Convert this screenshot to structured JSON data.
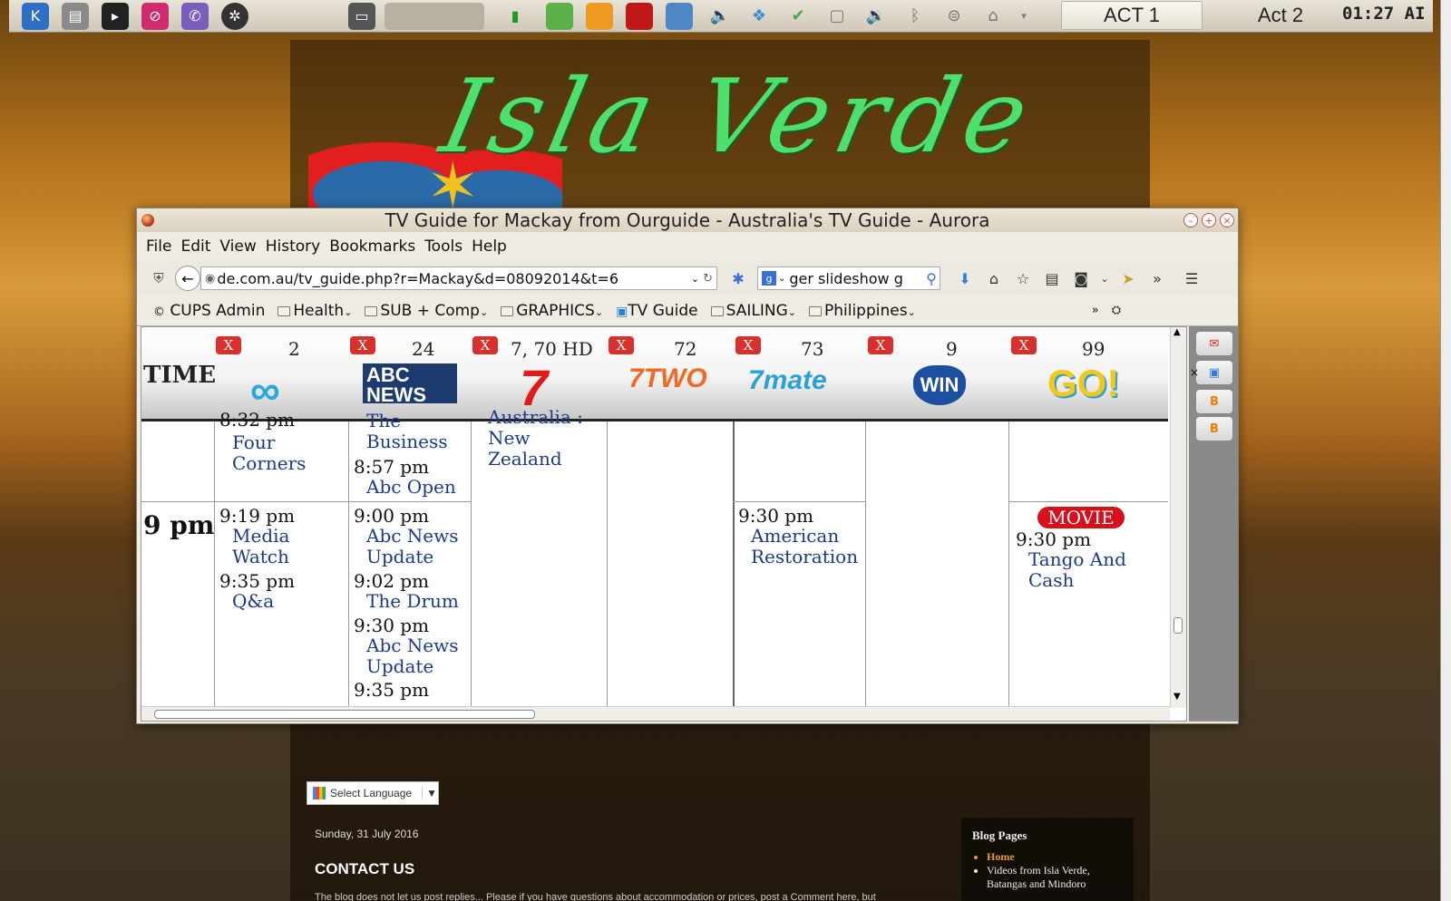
{
  "panel": {
    "act1": "ACT 1",
    "act2": "Act 2",
    "clock": "01:27 AI"
  },
  "blog": {
    "title": "Isla Verde",
    "language_select": "Select Language",
    "post_date": "Sunday, 31 July 2016",
    "post_title": "CONTACT US",
    "post_body": "The blog does not let us post replies... Please if you have questions about accommodation or prices, post a Comment here, but",
    "sidebar_title": "Blog Pages",
    "sidebar_items": [
      "Home",
      "Videos from Isla Verde, Batangas and Mindoro"
    ]
  },
  "browser": {
    "title": "TV Guide for Mackay from Ourguide - Australia's TV Guide - Aurora",
    "menu": [
      "File",
      "Edit",
      "View",
      "History",
      "Bookmarks",
      "Tools",
      "Help"
    ],
    "url": "de.com.au/tv_guide.php?r=Mackay&d=08092014&t=6",
    "search": "ger slideshow g",
    "bookmarks": [
      "CUPS Admin",
      "Health",
      "SUB + Comp",
      "GRAPHICS",
      "TV Guide",
      "SAILING",
      "Philippines"
    ]
  },
  "guide": {
    "time_header": "TIME",
    "close_label": "X",
    "channels": [
      {
        "num": "2",
        "logo": "ABC"
      },
      {
        "num": "24",
        "logo": "ABC NEWS 24"
      },
      {
        "num": "7, 70 HD",
        "logo": "7"
      },
      {
        "num": "72",
        "logo": "7TWO"
      },
      {
        "num": "73",
        "logo": "7mate"
      },
      {
        "num": "9",
        "logo": "WIN"
      },
      {
        "num": "99",
        "logo": "GO!"
      }
    ],
    "hour_label": "9 pm",
    "movie_badge": "MOVIE",
    "listings": {
      "c1_t0": "8:32 pm",
      "c1_s0": "Four Corners",
      "c2_s0": "The Business",
      "c2_t1": "8:57 pm",
      "c2_s1": "Abc Open",
      "c3_s0": "Australia : New Zealand",
      "c1_t1": "9:19 pm",
      "c1_s1": "Media Watch",
      "c1_t2": "9:35 pm",
      "c1_s2": "Q&a",
      "c2_t2": "9:00 pm",
      "c2_s2": "Abc News Update",
      "c2_t3": "9:02 pm",
      "c2_s3": "The Drum",
      "c2_t4": "9:30 pm",
      "c2_s4": "Abc News Update",
      "c2_t5": "9:35 pm",
      "c5_t1": "9:30 pm",
      "c5_s1": "American Restoration",
      "c7_t1": "9:30 pm",
      "c7_s1": "Tango And Cash"
    }
  }
}
